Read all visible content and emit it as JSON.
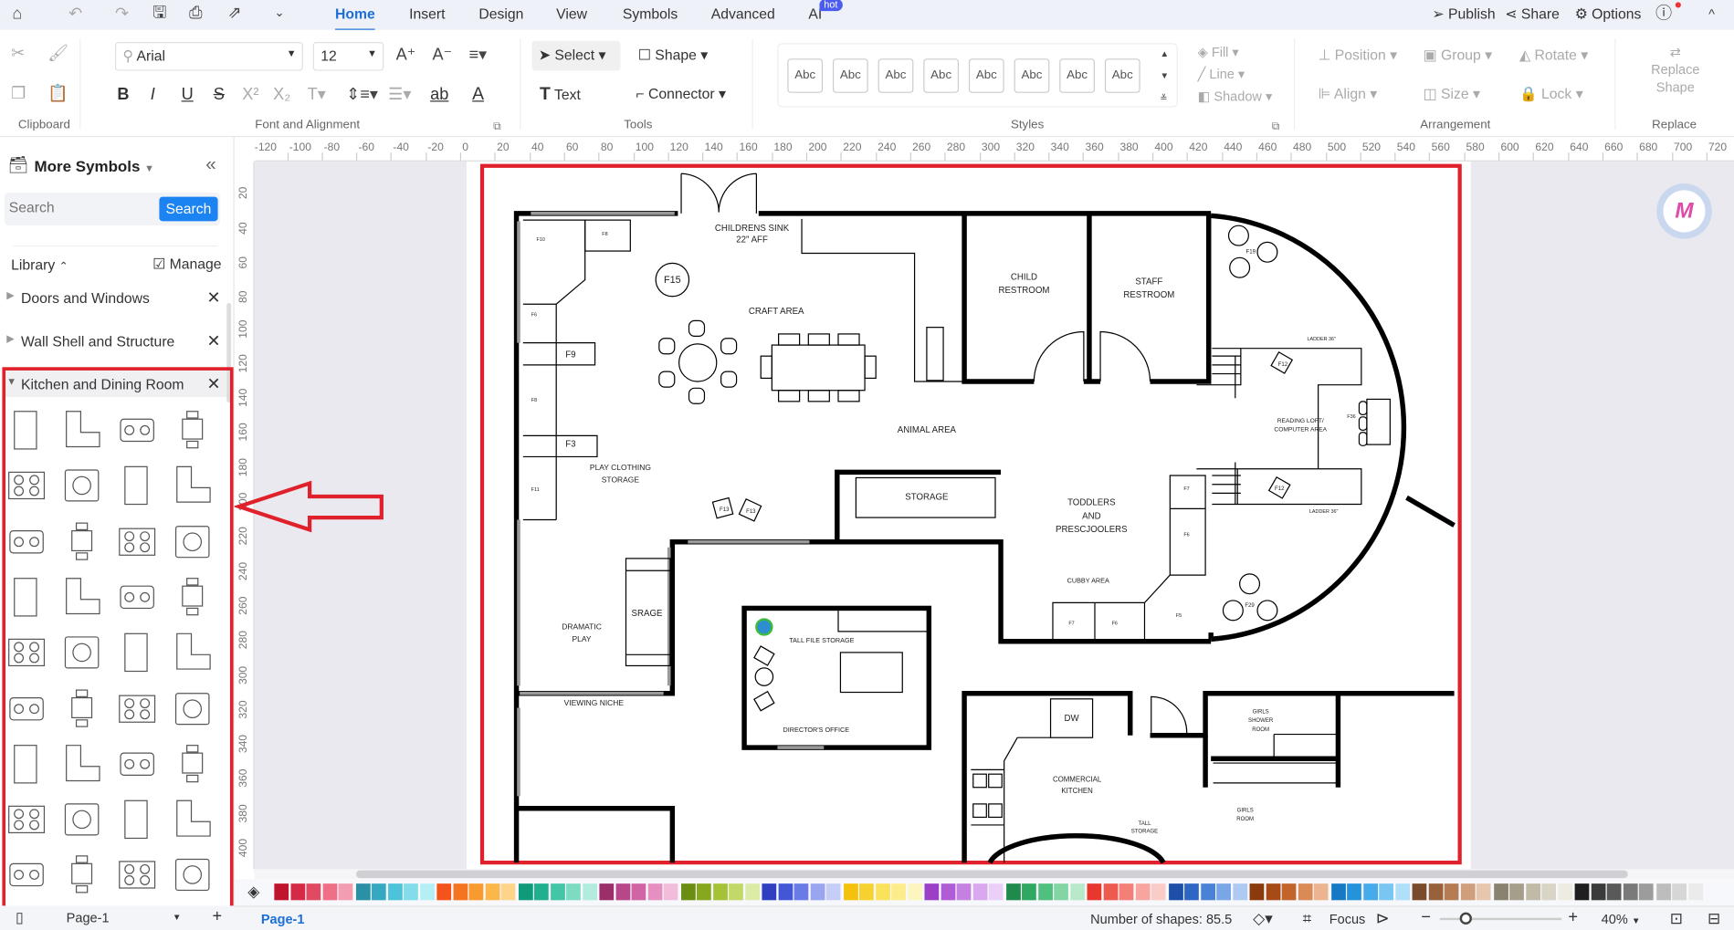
{
  "menubar": {
    "tabs": [
      "Home",
      "Insert",
      "Design",
      "View",
      "Symbols",
      "Advanced",
      "AI"
    ],
    "hot_badge": "hot",
    "active": "Home",
    "right": {
      "publish": "Publish",
      "share": "Share",
      "options": "Options"
    }
  },
  "ribbon": {
    "font": {
      "family": "Arial",
      "size": "12"
    },
    "tools": {
      "select": "Select",
      "shape": "Shape",
      "text": "Text",
      "connector": "Connector"
    },
    "styles": {
      "items": [
        "Abc",
        "Abc",
        "Abc",
        "Abc",
        "Abc",
        "Abc",
        "Abc",
        "Abc"
      ],
      "fill": "Fill",
      "line": "Line",
      "shadow": "Shadow"
    },
    "arrangement": {
      "position": "Position",
      "group": "Group",
      "rotate": "Rotate",
      "align": "Align",
      "size": "Size",
      "lock": "Lock"
    },
    "replace": {
      "line1": "Replace",
      "line2": "Shape"
    },
    "format": {
      "bold": "B",
      "italic": "I",
      "underline": "U",
      "strike": "S",
      "superscript": "X²",
      "subscript": "X₂",
      "highlight": "ab",
      "fontcolor": "A"
    },
    "groups": [
      "Clipboard",
      "Font and Alignment",
      "Tools",
      "Styles",
      "Arrangement",
      "Replace"
    ]
  },
  "sidebar": {
    "title": "More Symbols",
    "search_placeholder": "Search",
    "search_button": "Search",
    "library": "Library",
    "manage": "Manage",
    "libraries": [
      {
        "name": "Doors and Windows",
        "expanded": false
      },
      {
        "name": "Wall Shell and Structure",
        "expanded": false
      },
      {
        "name": "Kitchen and Dining Room",
        "expanded": true
      }
    ],
    "symbols": [
      "cabinet",
      "corner-cabinet",
      "l-counter",
      "l-counter-curved",
      "angled-counter",
      "half-round-table",
      "rectangle-table",
      "rounded-table",
      "half-circle",
      "square-table-4",
      "square-table-chairs",
      "round-table-chairs",
      "rect-table-4",
      "rect-table-6",
      "cooktop-2",
      "cooktop-2-oven",
      "washer",
      "double-burner",
      "stove-4",
      "stove-round",
      "range-6",
      "stove-6",
      "stove-8",
      "stove-6b",
      "burner-4",
      "oven",
      "cooktop-4",
      "cooktop-6",
      "burner-grid",
      "placeholder",
      "microwave",
      "tray",
      "dishwasher",
      "fridge",
      "sink",
      "scale"
    ]
  },
  "ruler": {
    "h_ticks": [
      -120,
      -100,
      -80,
      -60,
      -40,
      -20,
      0,
      20,
      40,
      60,
      80,
      100,
      120,
      140,
      160,
      180,
      200,
      220,
      240,
      260,
      280,
      300,
      320,
      340,
      360,
      380,
      400,
      420,
      440,
      460,
      480,
      500,
      520,
      540,
      560,
      580,
      600,
      620,
      640,
      660,
      680,
      700,
      720
    ],
    "v_ticks": [
      20,
      40,
      60,
      80,
      100,
      120,
      140,
      160,
      180,
      200,
      220,
      240,
      260,
      280,
      300,
      320,
      340,
      360,
      380,
      400
    ]
  },
  "plan": {
    "sink": [
      "CHILDRENS SINK",
      "22\" AFF"
    ],
    "f15": "F15",
    "craft": "CRAFT AREA",
    "animal": "ANIMAL AREA",
    "storage": "STORAGE",
    "child_restroom": [
      "CHILD",
      "RESTROOM"
    ],
    "staff_restroom": [
      "STAFF",
      "RESTROOM"
    ],
    "f19": "F19",
    "ladder": [
      "LADDER 36\"",
      "LADDER 36\""
    ],
    "loft": [
      "READING LOFT/",
      "COMPUTER AREA"
    ],
    "f36": "F36",
    "f12": [
      "F12",
      "F12"
    ],
    "toddlers": [
      "TODDLERS",
      "AND",
      "PRESCJOOLERS"
    ],
    "cubby": "CUBBY AREA",
    "f29": "F29",
    "shelves": [
      "F10",
      "F8",
      "F6",
      "F9",
      "F8",
      "F3",
      "F11",
      "F7",
      "F6",
      "F5",
      "F7",
      "F6"
    ],
    "f13": [
      "F13",
      "F13"
    ],
    "play_clothing": [
      "PLAY CLOTHING",
      "STORAGE"
    ],
    "dramatic": [
      "DRAMATIC",
      "PLAY"
    ],
    "srage": "SRAGE",
    "viewing": "VIEWING NICHE",
    "tall_file": "TALL FILE STORAGE",
    "director": "DIRECTOR'S OFFICE",
    "dw": "DW",
    "kitchen": [
      "COMMERCIAL",
      "KITCHEN"
    ],
    "tall_storage": [
      "TALL",
      "STORAGE"
    ],
    "girls_shower": [
      "GIRLS",
      "SHOWER",
      "ROOM"
    ],
    "girls_room": [
      "GIRLS",
      "ROOM"
    ]
  },
  "annotation": {
    "highlight_color": "#e0202a",
    "arrow": "left"
  },
  "palette": [
    "#c0142c",
    "#d42a45",
    "#e04a62",
    "#ef6f86",
    "#f49db0",
    "#2b8fa6",
    "#35a9c2",
    "#4cc3d9",
    "#82dcea",
    "#b6eef6",
    "#f2541b",
    "#f5741f",
    "#f99a2e",
    "#fbb74a",
    "#fdd48a",
    "#0f9a7a",
    "#20b08f",
    "#42c6a6",
    "#7ddbc4",
    "#b3ecdf",
    "#9c2f6b",
    "#b84789",
    "#d064a4",
    "#e690c2",
    "#f2bddb",
    "#6b8e12",
    "#86a81e",
    "#a3c235",
    "#c2d96a",
    "#dceba6",
    "#2e3fbf",
    "#4256d6",
    "#6a7ae6",
    "#9aa5f0",
    "#c6cdf7",
    "#f4c20d",
    "#f7d22e",
    "#fae25a",
    "#fcec8c",
    "#fdf5bf",
    "#9a3fc6",
    "#b05cd6",
    "#c581e2",
    "#d9a8ee",
    "#ead0f6",
    "#1f8a4c",
    "#2fa862",
    "#50c07e",
    "#83d6a4",
    "#b8e9cb",
    "#e8372c",
    "#ef5a4f",
    "#f47f76",
    "#f8a59f",
    "#fbcbc7",
    "#1e4fa8",
    "#2d66c4",
    "#4a82d8",
    "#79a6e6",
    "#aecaf2",
    "#8b3a0e",
    "#a64b16",
    "#c2652b",
    "#d98a55",
    "#ecb590",
    "#1779c4",
    "#2592dc",
    "#45abeb",
    "#7ac6f3",
    "#b0dff9",
    "#7a4a2c",
    "#98603b",
    "#b57c53",
    "#cf9f7d",
    "#e6c7ad",
    "#8a8270",
    "#a59e8a",
    "#c0baa6",
    "#d9d5c6",
    "#eeebe2",
    "#1f1f1f",
    "#3b3b3b",
    "#595959",
    "#7a7a7a",
    "#9c9c9c",
    "#bdbdbd",
    "#d6d6d6",
    "#ebebeb"
  ],
  "status": {
    "page_select": "Page-1",
    "page_tab": "Page-1",
    "shapes": "Number of shapes: 85.5",
    "focus": "Focus",
    "zoom": "40%",
    "zoom_level": 40
  }
}
